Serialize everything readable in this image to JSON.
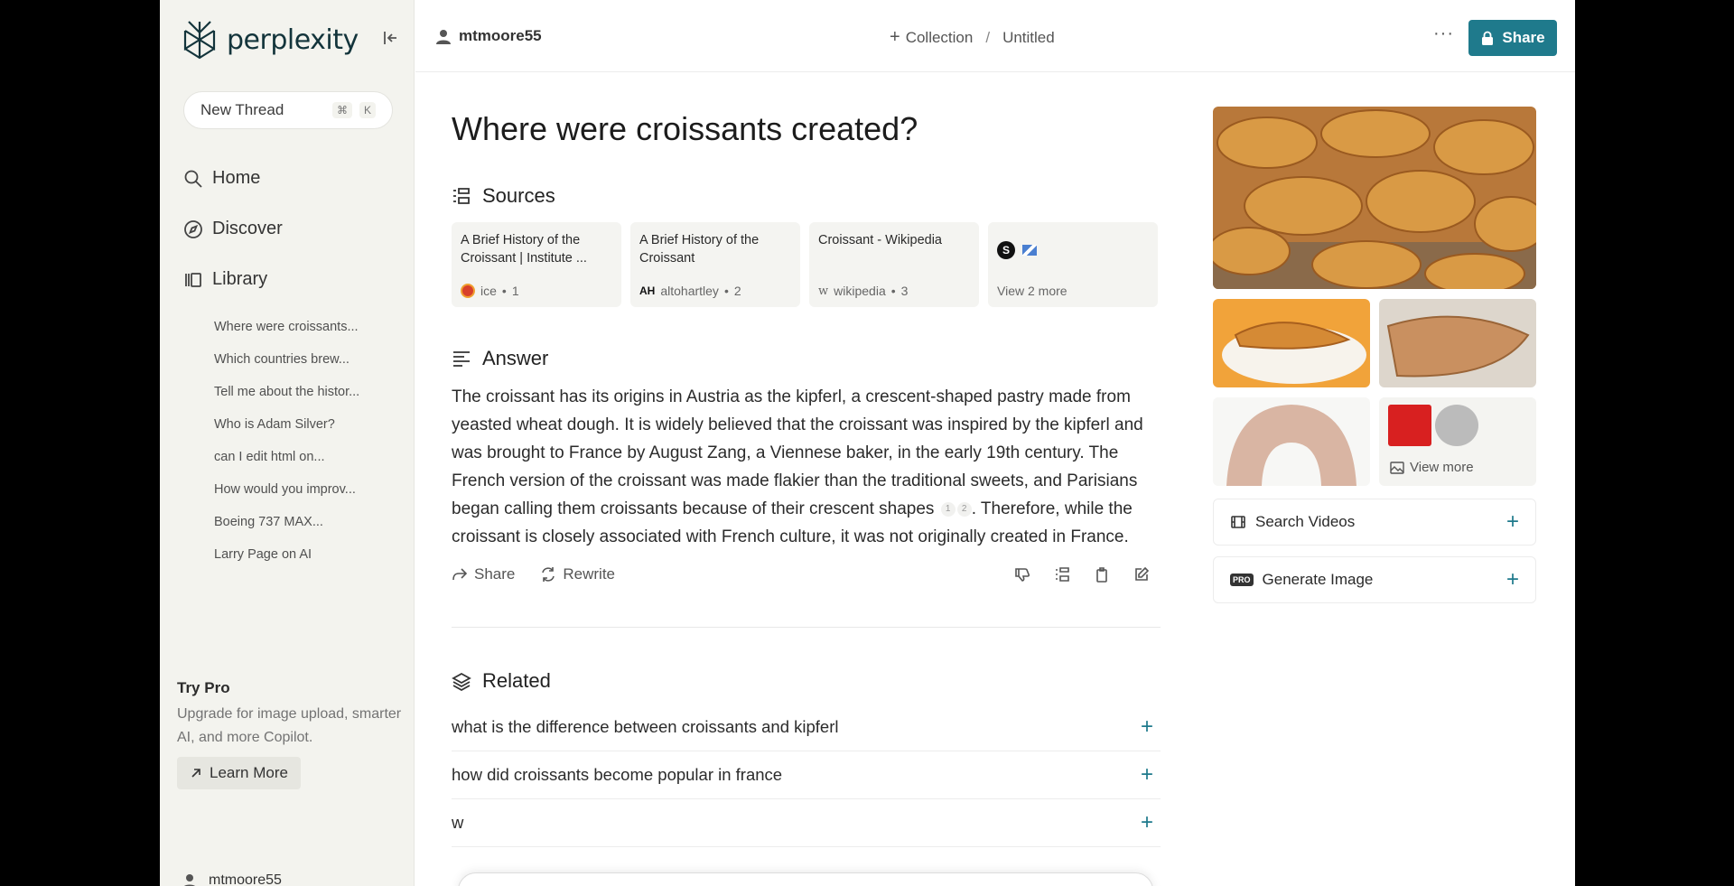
{
  "sidebar": {
    "brand": "perplexity",
    "new_thread": {
      "label": "New Thread",
      "kbd": [
        "⌘",
        "K"
      ]
    },
    "nav": [
      {
        "label": "Home",
        "icon": "search-icon"
      },
      {
        "label": "Discover",
        "icon": "compass-icon"
      },
      {
        "label": "Library",
        "icon": "library-icon"
      }
    ],
    "library_items": [
      "Where were croissants...",
      "Which countries brew...",
      "Tell me about the histor...",
      "Who is Adam Silver?",
      "can I edit html on...",
      "How would you improv...",
      "Boeing 737 MAX...",
      "Larry Page on AI"
    ],
    "try_pro": {
      "title": "Try Pro",
      "text": "Upgrade for image upload, smarter AI, and more Copilot.",
      "button": "Learn More"
    },
    "user": "mtmoore55"
  },
  "topbar": {
    "user": "mtmoore55",
    "collection": "Collection",
    "separator": "/",
    "doc_title": "Untitled",
    "more": "···",
    "share": "Share"
  },
  "main": {
    "question": "Where were croissants created?",
    "sources_heading": "Sources",
    "sources": [
      {
        "title": "A Brief History of the Croissant | Institute ...",
        "site": "ice",
        "num": "1"
      },
      {
        "title": "A Brief History of the Croissant",
        "site": "altohartley",
        "num": "2"
      },
      {
        "title": "Croissant - Wikipedia",
        "site": "wikipedia",
        "num": "3"
      }
    ],
    "view_more_sources": "View 2 more",
    "answer_heading": "Answer",
    "answer_part1": "The croissant has its origins in Austria as the kipferl, a crescent-shaped pastry made from yeasted wheat dough. It is widely believed that the croissant was inspired by the kipferl and was brought to France by August Zang, a Viennese baker, in the early 19th century. The French version of the croissant was made flakier than the traditional sweets, and Parisians began calling them croissants because of their crescent shapes",
    "cite1": "1",
    "cite2": "2",
    "answer_part2": ". Therefore, while the croissant is closely associated with French culture, it was not originally created in France.",
    "actions": {
      "share": "Share",
      "rewrite": "Rewrite"
    },
    "related_heading": "Related",
    "related": [
      "what is the difference between croissants and kipferl",
      "how did croissants become popular in france",
      "w"
    ]
  },
  "right": {
    "view_more": "View more",
    "search_videos": "Search Videos",
    "generate_image": "Generate Image"
  },
  "colors": {
    "accent": "#1f7a8c",
    "sidebar_bg": "#f3f3ee",
    "card_bg": "#f4f4f1"
  }
}
